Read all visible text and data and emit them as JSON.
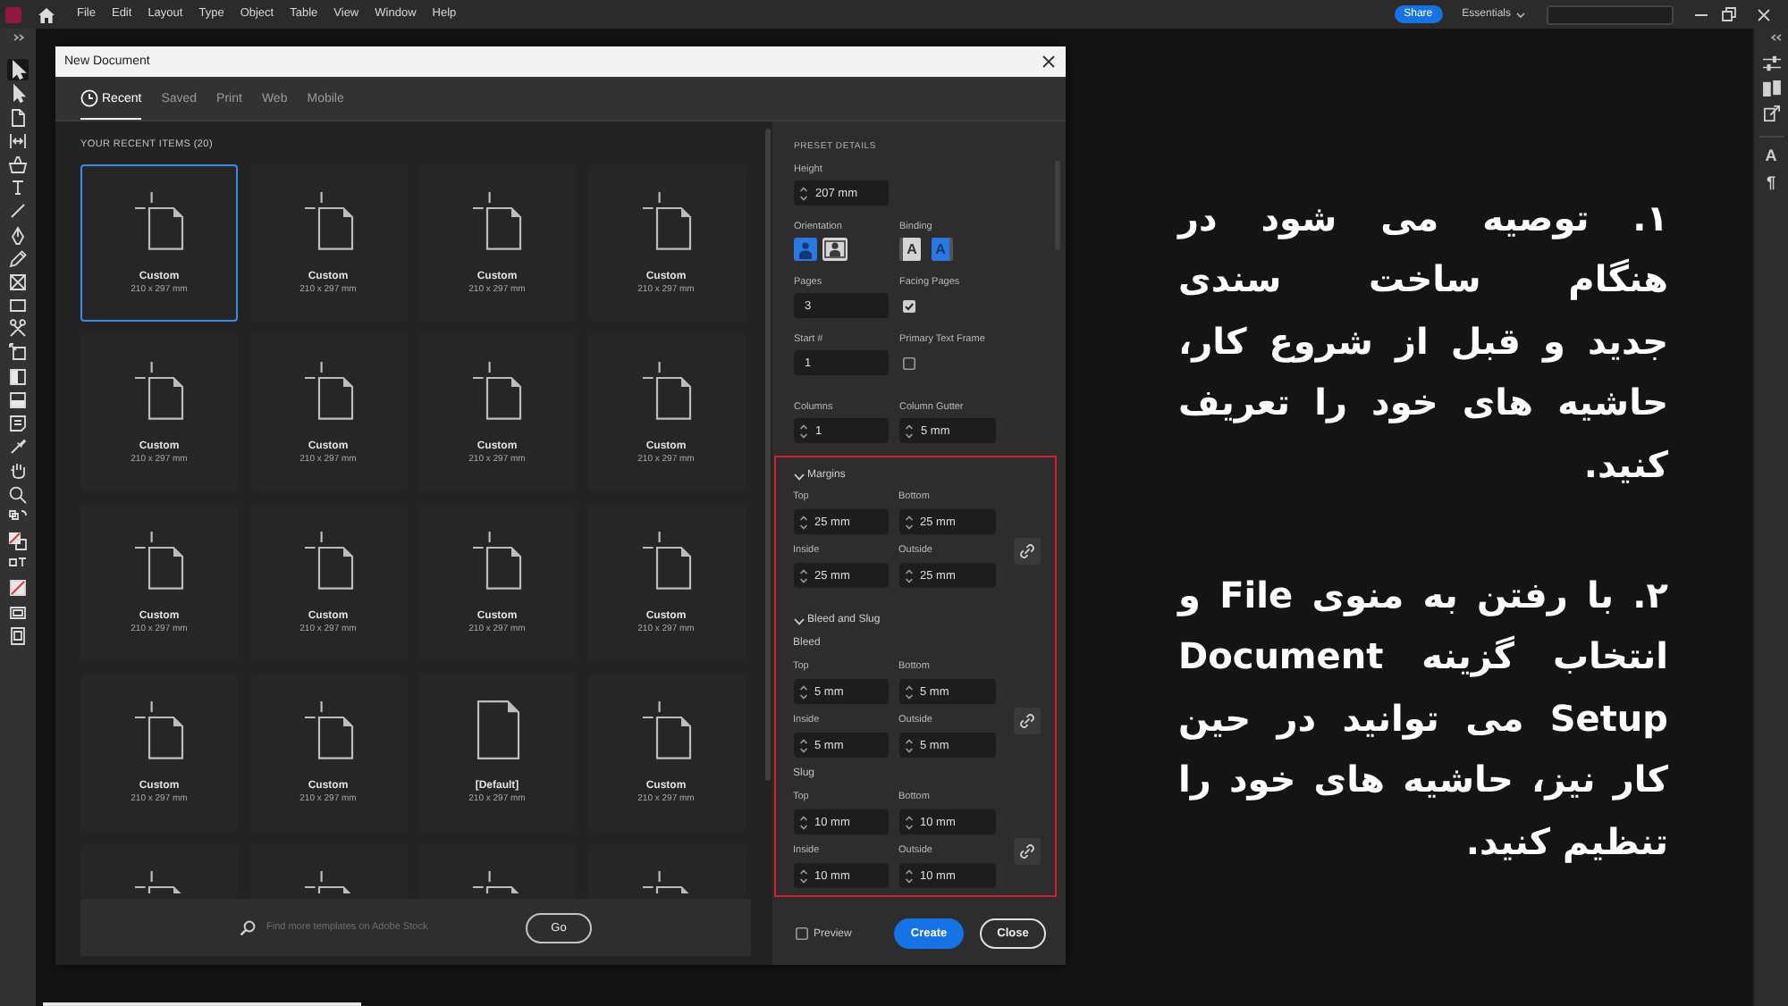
{
  "menu_bar": {
    "items": [
      "File",
      "Edit",
      "Layout",
      "Type",
      "Object",
      "Table",
      "View",
      "Window",
      "Help"
    ],
    "share": "Share",
    "workspace": "Essentials"
  },
  "toolbar": [
    {
      "selected": true
    },
    {
      "selected": false
    },
    {
      "selected": false
    },
    {
      "selected": false
    },
    {
      "selected": false
    },
    {
      "selected": false
    },
    {
      "selected": false
    },
    {
      "selected": false
    },
    {
      "selected": false
    },
    {
      "selected": false
    },
    {
      "selected": false
    },
    {
      "selected": false
    },
    {
      "selected": false
    },
    {
      "selected": false
    },
    {
      "selected": false
    },
    {
      "selected": false
    },
    {
      "selected": false
    },
    {
      "selected": false
    },
    {
      "selected": false
    },
    {
      "selected": false
    },
    {
      "selected": false
    },
    {
      "selected": false
    },
    {
      "selected": false
    },
    {
      "selected": false
    },
    {
      "selected": false
    }
  ],
  "panel_strip": {
    "buttons": [
      "A",
      "¶"
    ]
  },
  "dialog": {
    "title": "New Document",
    "tabs": [
      {
        "label": "Recent",
        "selected": true
      },
      {
        "label": "Saved",
        "selected": false
      },
      {
        "label": "Print",
        "selected": false
      },
      {
        "label": "Web",
        "selected": false
      },
      {
        "label": "Mobile",
        "selected": false
      }
    ],
    "recent": {
      "heading": "YOUR RECENT ITEMS (20)",
      "items": [
        {
          "kind": "custom",
          "name": "Custom",
          "size": "210 x 297 mm",
          "selected": true
        },
        {
          "kind": "custom",
          "name": "Custom",
          "size": "210 x 297 mm",
          "selected": false
        },
        {
          "kind": "custom",
          "name": "Custom",
          "size": "210 x 297 mm",
          "selected": false
        },
        {
          "kind": "custom",
          "name": "Custom",
          "size": "210 x 297 mm",
          "selected": false
        },
        {
          "kind": "custom",
          "name": "Custom",
          "size": "210 x 297 mm",
          "selected": false
        },
        {
          "kind": "custom",
          "name": "Custom",
          "size": "210 x 297 mm",
          "selected": false
        },
        {
          "kind": "custom",
          "name": "Custom",
          "size": "210 x 297 mm",
          "selected": false
        },
        {
          "kind": "custom",
          "name": "Custom",
          "size": "210 x 297 mm",
          "selected": false
        },
        {
          "kind": "custom",
          "name": "Custom",
          "size": "210 x 297 mm",
          "selected": false
        },
        {
          "kind": "custom",
          "name": "Custom",
          "size": "210 x 297 mm",
          "selected": false
        },
        {
          "kind": "custom",
          "name": "Custom",
          "size": "210 x 297 mm",
          "selected": false
        },
        {
          "kind": "custom",
          "name": "Custom",
          "size": "210 x 297 mm",
          "selected": false
        },
        {
          "kind": "custom",
          "name": "Custom",
          "size": "210 x 297 mm",
          "selected": false
        },
        {
          "kind": "custom",
          "name": "Custom",
          "size": "210 x 297 mm",
          "selected": false
        },
        {
          "kind": "default",
          "name": "[Default]",
          "size": "210 x 297 mm",
          "selected": false
        },
        {
          "kind": "custom",
          "name": "Custom",
          "size": "210 x 297 mm",
          "selected": false
        },
        {
          "kind": "custom",
          "selected": false
        },
        {
          "kind": "custom",
          "selected": false
        },
        {
          "kind": "custom",
          "selected": false
        },
        {
          "kind": "custom",
          "selected": false
        }
      ]
    },
    "search": {
      "placeholder": "Find more templates on Adobe Stock",
      "button": "Go"
    },
    "preset": {
      "heading": "PRESET DETAILS",
      "rows": [
        {
          "cells": [
            {
              "label": "Height",
              "kind": "spinner",
              "value": "207 mm"
            }
          ]
        },
        {
          "cells": [
            {
              "label": "Orientation",
              "kind": "orientation",
              "options": [
                {
                  "kind": "portrait",
                  "selected": true
                },
                {
                  "kind": "landscape",
                  "selected": false
                }
              ]
            },
            {
              "label": "Binding",
              "kind": "binding",
              "options": [
                {
                  "kind": "left-to-right",
                  "glyph": "A",
                  "selected": false
                },
                {
                  "kind": "right-to-left",
                  "glyph": "A",
                  "selected": true
                }
              ]
            }
          ]
        },
        {
          "cells": [
            {
              "label": "Pages",
              "kind": "plain",
              "value": "3"
            },
            {
              "label": "Facing Pages",
              "kind": "checkbox",
              "checked": true
            }
          ]
        },
        {
          "cells": [
            {
              "label": "Start #",
              "kind": "plain",
              "value": "1"
            },
            {
              "label": "Primary Text Frame",
              "kind": "checkbox",
              "checked": false
            }
          ]
        },
        {
          "cells": [
            {
              "label": "Columns",
              "kind": "spinner",
              "value": "1"
            },
            {
              "label": "Column Gutter",
              "kind": "spinner",
              "value": "5 mm"
            }
          ]
        }
      ],
      "highlighted": true,
      "sections": [
        {
          "title": "Margins",
          "expanded": true,
          "groups": [
            {
              "fields": [
                {
                  "label": "Top",
                  "value": "25 mm"
                },
                {
                  "label": "Bottom",
                  "value": "25 mm"
                },
                {
                  "label": "Inside",
                  "value": "25 mm"
                },
                {
                  "label": "Outside",
                  "value": "25 mm"
                }
              ]
            }
          ]
        },
        {
          "title": "Bleed and Slug",
          "expanded": true,
          "groups": [
            {
              "label": "Bleed",
              "fields": [
                {
                  "label": "Top",
                  "value": "5 mm"
                },
                {
                  "label": "Bottom",
                  "value": "5 mm"
                },
                {
                  "label": "Inside",
                  "value": "5 mm"
                },
                {
                  "label": "Outside",
                  "value": "5 mm"
                }
              ]
            },
            {
              "label": "Slug",
              "fields": [
                {
                  "label": "Top",
                  "value": "10 mm"
                },
                {
                  "label": "Bottom",
                  "value": "10 mm"
                },
                {
                  "label": "Inside",
                  "value": "10 mm"
                },
                {
                  "label": "Outside",
                  "value": "10 mm"
                }
              ]
            }
          ]
        }
      ]
    },
    "footer": {
      "preview": {
        "label": "Preview",
        "checked": false
      },
      "create": "Create",
      "close": "Close"
    }
  },
  "instructions": [
    {
      "lines": [
        "۱. توصیه می شود در",
        "هنگام ساخت سندی",
        "جدید و قبل از شروع کار،",
        "حاشیه های خود را تعریف",
        "کنید."
      ]
    },
    {
      "lines": [
        "۲. با رفتن به منوی File و",
        "انتخاب گزینه Document",
        "Setup می توانید در حین",
        "کار نیز، حاشیه های خود را",
        "تنظیم کنید."
      ]
    }
  ]
}
